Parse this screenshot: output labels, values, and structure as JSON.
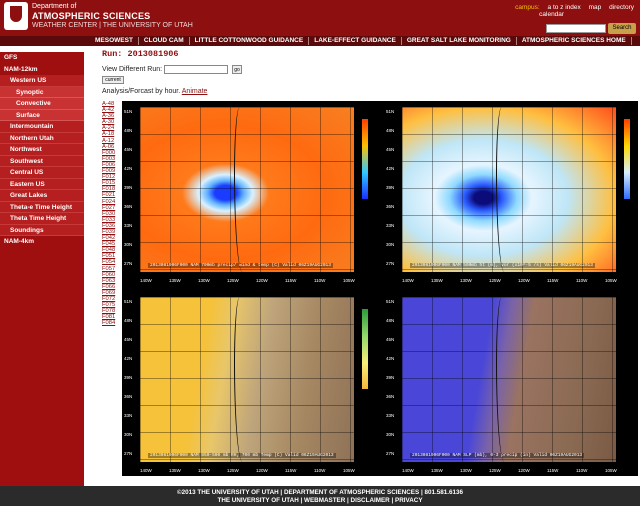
{
  "header": {
    "dept": "Department of",
    "dept_name": "ATMOSPHERIC SCIENCES",
    "dept_sub": "WEATHER CENTER | THE UNIVERSITY OF UTAH",
    "campus_label": "campus:",
    "links": [
      "a to z index",
      "map",
      "directory",
      "calendar"
    ],
    "search_label": "Search"
  },
  "nav": [
    "MESOWEST",
    "CLOUD CAM",
    "LITTLE COTTONWOOD GUIDANCE",
    "LAKE-EFFECT GUIDANCE",
    "GREAT SALT LAKE MONITORING",
    "ATMOSPHERIC SCIENCES HOME"
  ],
  "sidebar": [
    {
      "label": "GFS",
      "level": 0
    },
    {
      "label": "NAM-12km",
      "level": 0
    },
    {
      "label": "Western US",
      "level": 1
    },
    {
      "label": "Synoptic",
      "level": 2
    },
    {
      "label": "Convective",
      "level": 2
    },
    {
      "label": "Surface",
      "level": 2
    },
    {
      "label": "Intermountain",
      "level": 1
    },
    {
      "label": "Northern Utah",
      "level": 1
    },
    {
      "label": "Northwest",
      "level": 1
    },
    {
      "label": "Southwest",
      "level": 1
    },
    {
      "label": "Central US",
      "level": 1
    },
    {
      "label": "Eastern US",
      "level": 1
    },
    {
      "label": "Great Lakes",
      "level": 1
    },
    {
      "label": "Theta-e Time Height",
      "level": 1
    },
    {
      "label": "Theta Time Height",
      "level": 1
    },
    {
      "label": "Soundings",
      "level": 1
    },
    {
      "label": "NAM-4km",
      "level": 0
    }
  ],
  "main": {
    "run_title": "Run: 2013081906",
    "view_label": "View Different Run:",
    "run_input_value": "",
    "go_label": "go",
    "current_label": "current",
    "analysis_label": "Analysis/Forcast by hour.",
    "animate_label": "Animate",
    "hours": [
      "A-48",
      "A-42",
      "A-36",
      "A-30",
      "A-24",
      "A-18",
      "A-12",
      "A-06",
      "F000",
      "F003",
      "F006",
      "F009",
      "F012",
      "F015",
      "F018",
      "F021",
      "F024",
      "F027",
      "F030",
      "F033",
      "F036",
      "F039",
      "F042",
      "F045",
      "F048",
      "F051",
      "F054",
      "F057",
      "F060",
      "F063",
      "F066",
      "F069",
      "F072",
      "F075",
      "F078",
      "F081",
      "F084"
    ]
  },
  "panels": [
    {
      "caption": "2013081906F000 NAM 700mb precip/ wind & temp (C)  Valid 06Z19AUG2013"
    },
    {
      "caption": "2013081906F000 NAM 500mb ht (m), vor (x10^-5 /s)  Valid 06Z19AUG2013"
    },
    {
      "caption": "2013081906F000 NAM 850-500 mb RH, 700 mb Temp (C)  Valid 06Z19AUG2013"
    },
    {
      "caption": "2013081906F000 NAM SLP (mb), 0-3 precip (in)  Valid 06Z19AUG2013"
    }
  ],
  "lat_labels": [
    "51N",
    "48N",
    "45N",
    "42N",
    "39N",
    "36N",
    "33N",
    "30N",
    "27N"
  ],
  "lon_labels": [
    "140W",
    "135W",
    "130W",
    "125W",
    "120W",
    "115W",
    "110W",
    "105W"
  ],
  "footer": {
    "line1": "©2013 THE UNIVERSITY OF UTAH  |  DEPARTMENT OF ATMOSPHERIC SCIENCES  |  801.581.6136",
    "line2": "THE UNIVERSITY OF UTAH  |  WEBMASTER  |  DISCLAIMER  |  PRIVACY"
  }
}
